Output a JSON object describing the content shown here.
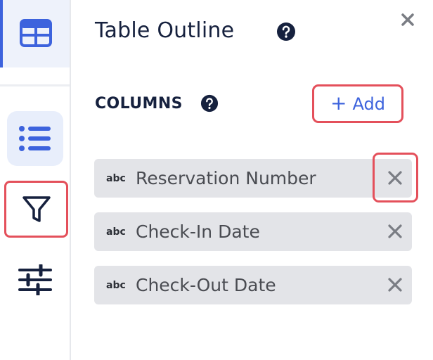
{
  "panel": {
    "title": "Table Outline",
    "section_label": "COLUMNS",
    "add_label": "Add",
    "add_symbol": "+"
  },
  "columns": [
    {
      "type": "abc",
      "name": "Reservation Number"
    },
    {
      "type": "abc",
      "name": "Check-In Date"
    },
    {
      "type": "abc",
      "name": "Check-Out Date"
    }
  ],
  "icons": {
    "rail": [
      "table-icon",
      "list-icon",
      "filter-icon",
      "sliders-icon"
    ],
    "panel": [
      "help-icon",
      "close-icon",
      "remove-icon"
    ]
  },
  "colors": {
    "accent": "#3d63dd",
    "highlight": "#e4505b",
    "heading": "#16213e",
    "row_bg": "#e3e4e8"
  }
}
